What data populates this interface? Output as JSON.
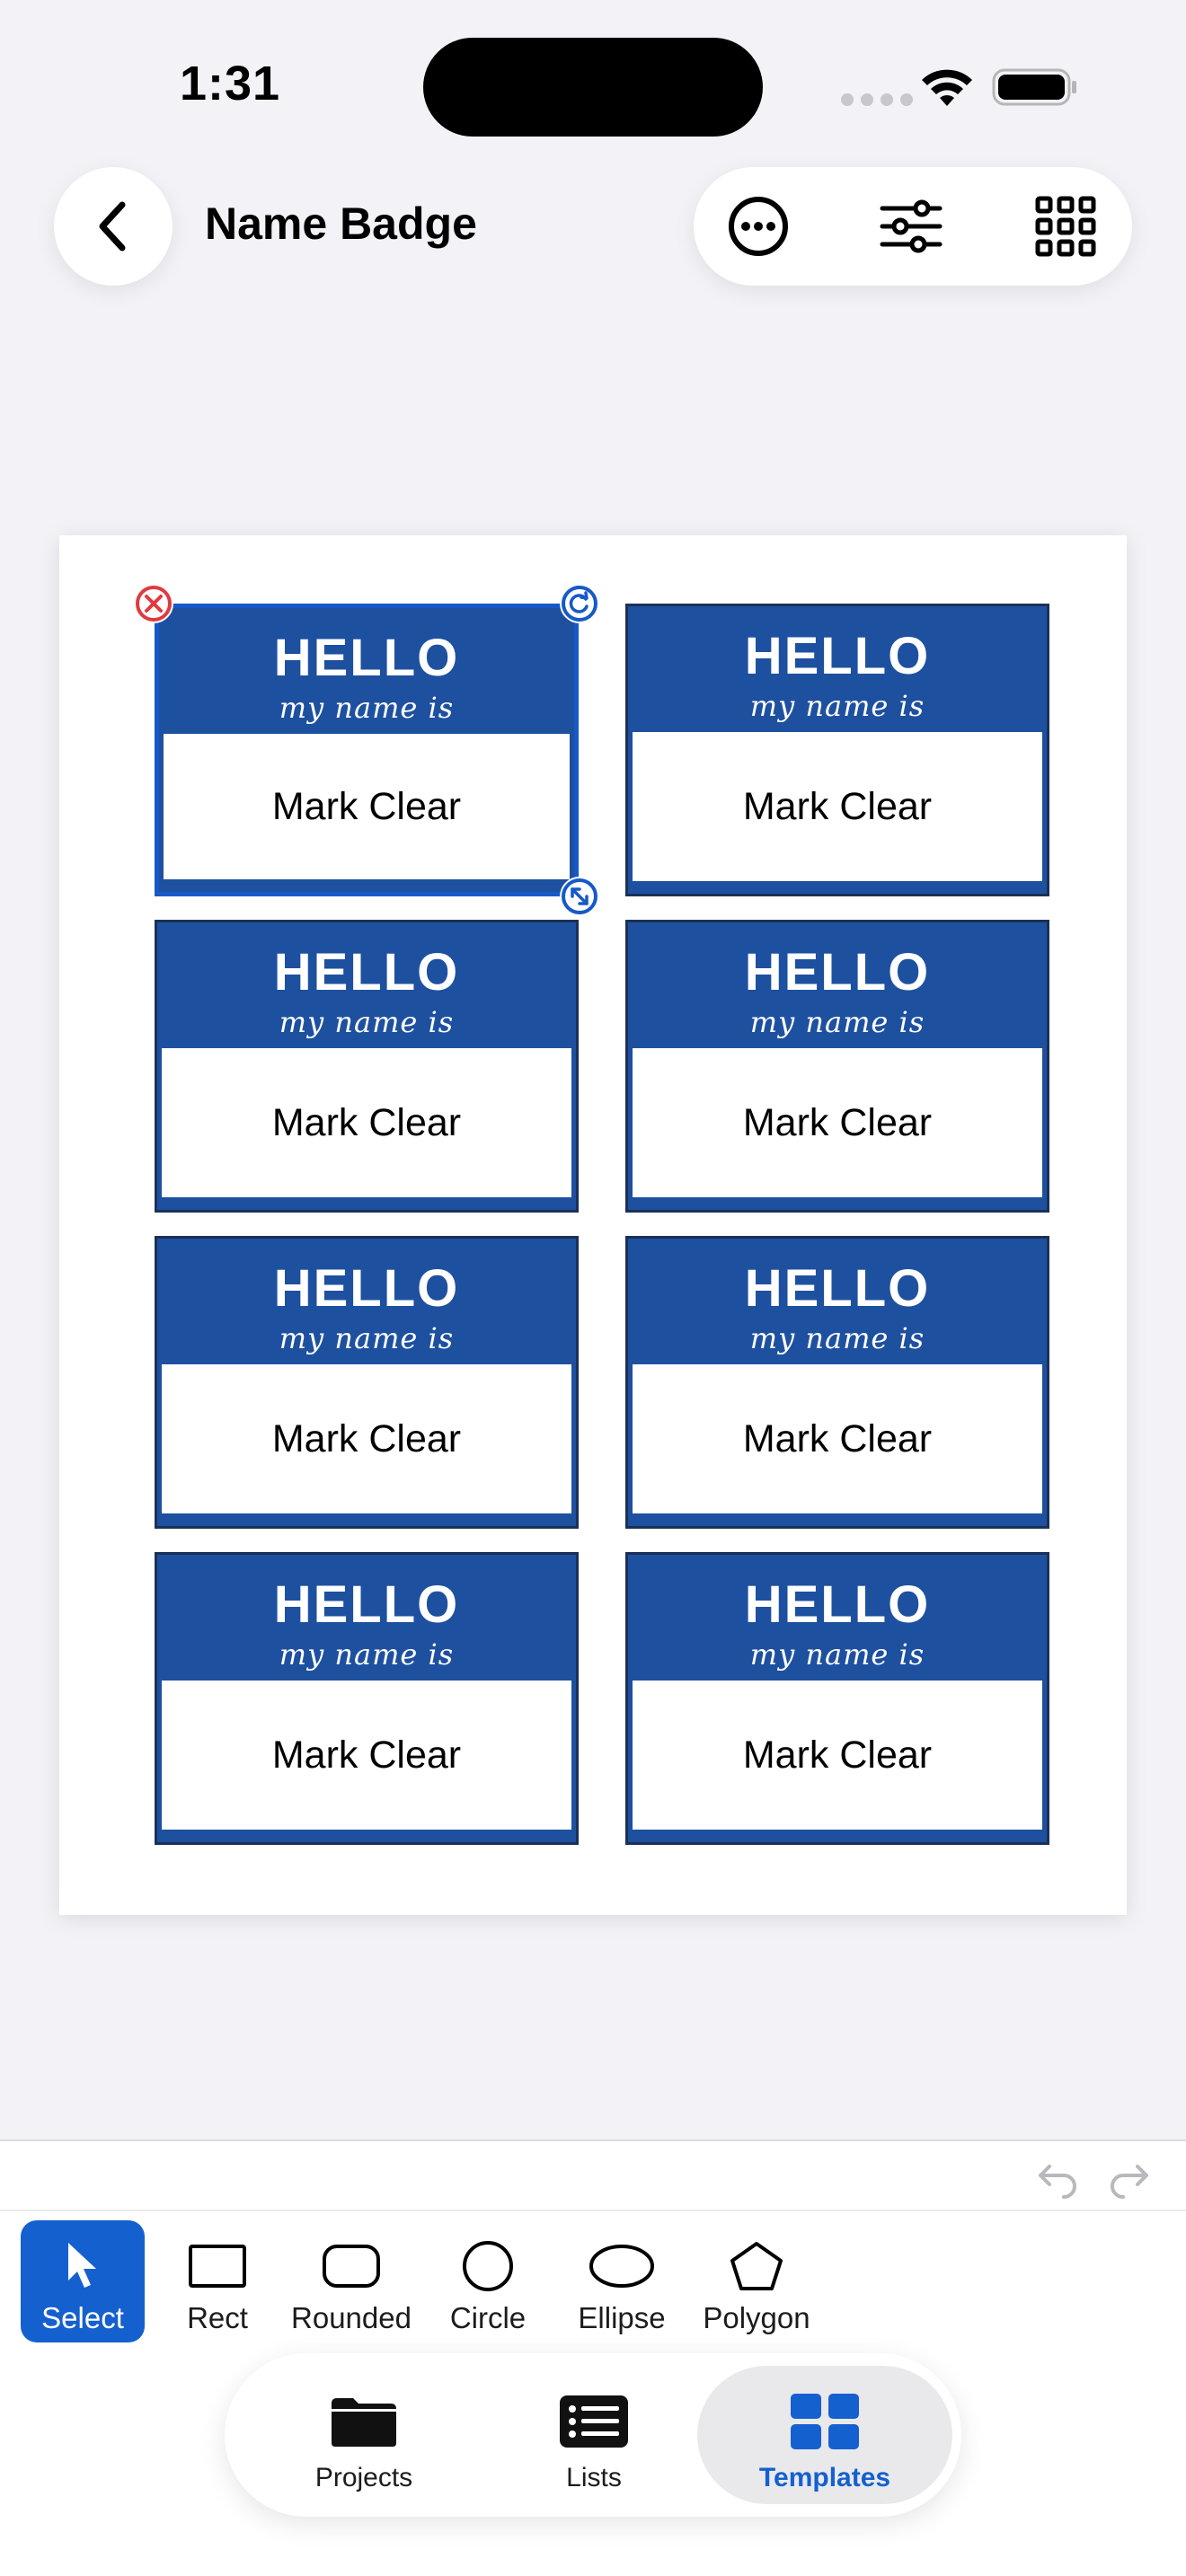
{
  "status_bar": {
    "time": "1:31",
    "icons": [
      "signal-dots-icon",
      "wifi-icon",
      "battery-icon"
    ]
  },
  "nav": {
    "title": "Name Badge",
    "back_icon": "chevron-left-icon",
    "actions": [
      "more-icon",
      "sliders-icon",
      "grid-icon"
    ]
  },
  "badges": [
    {
      "hello": "HELLO",
      "subtitle": "my name is",
      "name": "Mark Clear",
      "selected": true
    },
    {
      "hello": "HELLO",
      "subtitle": "my name is",
      "name": "Mark Clear",
      "selected": false
    },
    {
      "hello": "HELLO",
      "subtitle": "my name is",
      "name": "Mark Clear",
      "selected": false
    },
    {
      "hello": "HELLO",
      "subtitle": "my name is",
      "name": "Mark Clear",
      "selected": false
    },
    {
      "hello": "HELLO",
      "subtitle": "my name is",
      "name": "Mark Clear",
      "selected": false
    },
    {
      "hello": "HELLO",
      "subtitle": "my name is",
      "name": "Mark Clear",
      "selected": false
    },
    {
      "hello": "HELLO",
      "subtitle": "my name is",
      "name": "Mark Clear",
      "selected": false
    },
    {
      "hello": "HELLO",
      "subtitle": "my name is",
      "name": "Mark Clear",
      "selected": false
    }
  ],
  "tools": [
    {
      "label": "Select",
      "icon": "cursor-icon",
      "active": true
    },
    {
      "label": "Rect",
      "icon": "rect-icon",
      "active": false
    },
    {
      "label": "Rounded",
      "icon": "rounded-rect-icon",
      "active": false
    },
    {
      "label": "Circle",
      "icon": "circle-icon",
      "active": false
    },
    {
      "label": "Ellipse",
      "icon": "ellipse-icon",
      "active": false
    },
    {
      "label": "Polygon",
      "icon": "polygon-icon",
      "active": false
    }
  ],
  "tabs": [
    {
      "label": "Projects",
      "icon": "folder-icon",
      "active": false
    },
    {
      "label": "Lists",
      "icon": "list-icon",
      "active": false
    },
    {
      "label": "Templates",
      "icon": "templates-grid-icon",
      "active": true
    }
  ],
  "colors": {
    "accent": "#1560cf",
    "badge_blue": "#1e50a0",
    "badge_border": "#1b3057",
    "delete_red": "#e0393e",
    "background": "#f2f2f7"
  }
}
